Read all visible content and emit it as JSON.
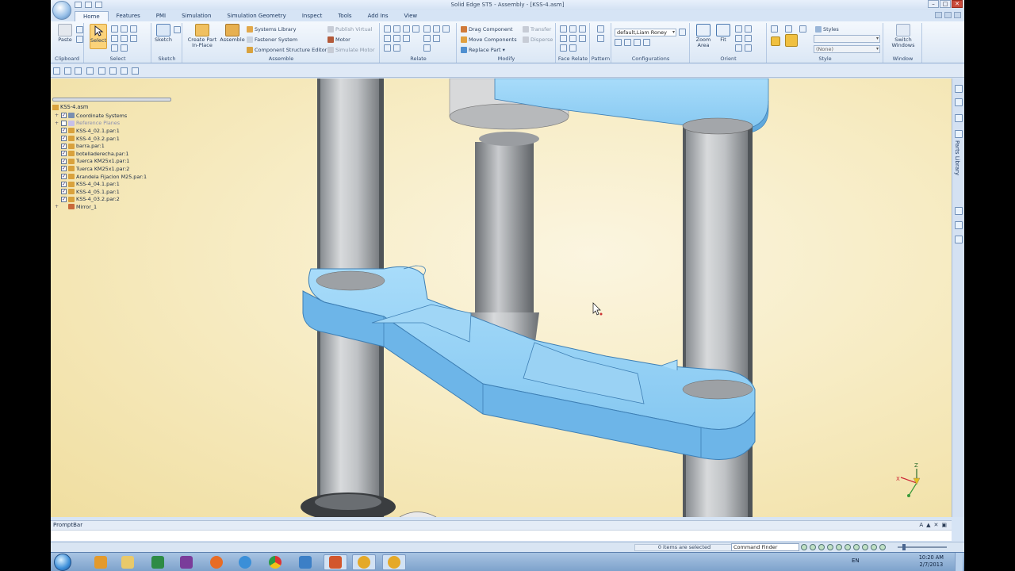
{
  "window": {
    "title": "Solid Edge ST5 - Assembly - [KSS-4.asm]"
  },
  "tabs": [
    "Home",
    "Features",
    "PMI",
    "Simulation",
    "Simulation Geometry",
    "Inspect",
    "Tools",
    "Add Ins",
    "View"
  ],
  "ribbon": {
    "clipboard": {
      "paste": "Paste",
      "label": "Clipboard"
    },
    "select": {
      "select": "Select",
      "label": "Select"
    },
    "sketch": {
      "sketch": "Sketch",
      "label": "Sketch"
    },
    "assemble": {
      "create_part": "Create Part",
      "in_place": "In-Place",
      "assemble": "Assemble",
      "systems_library": "Systems Library",
      "fastener_system": "Fastener System",
      "component_structure_editor": "Component Structure Editor",
      "publish_virtual": "Publish Virtual",
      "motor": "Motor",
      "simulate_motor": "Simulate Motor",
      "label": "Assemble"
    },
    "relate": {
      "label": "Relate"
    },
    "modify": {
      "drag_component": "Drag Component",
      "move_components": "Move Components",
      "replace_part": "Replace Part",
      "transfer": "Transfer",
      "disperse": "Disperse",
      "label": "Modify"
    },
    "face_relate": {
      "label": "Face Relate"
    },
    "pattern": {
      "label": "Pattern"
    },
    "configurations": {
      "combo_value": "default,Liam Roney",
      "label": "Configurations"
    },
    "orient": {
      "zoom_area_1": "Zoom",
      "zoom_area_2": "Area",
      "fit": "Fit",
      "label": "Orient"
    },
    "style": {
      "styles": "Styles",
      "none_value": "(None)",
      "label": "Style"
    },
    "window": {
      "switch_1": "Switch",
      "switch_2": "Windows",
      "label": "Window"
    }
  },
  "pathfinder": {
    "root": "KSS-4.asm",
    "items": [
      {
        "label": "Coordinate Systems",
        "expand": "+",
        "checked": true,
        "faded": false,
        "icon_color": "#7a8fb0"
      },
      {
        "label": "Reference Planes",
        "expand": "+",
        "checked": false,
        "faded": true,
        "icon_color": "#c7c0e8"
      },
      {
        "label": "KSS-4_02.1.par:1",
        "expand": "",
        "checked": true,
        "faded": false,
        "icon_color": "#d9a23d"
      },
      {
        "label": "KSS-4_03.2.par:1",
        "expand": "",
        "checked": true,
        "faded": false,
        "icon_color": "#d9a23d"
      },
      {
        "label": "barra.par:1",
        "expand": "",
        "checked": true,
        "faded": false,
        "icon_color": "#d9a23d"
      },
      {
        "label": "botelladerecha.par:1",
        "expand": "",
        "checked": true,
        "faded": false,
        "icon_color": "#d9a23d"
      },
      {
        "label": "Tuerca KM25x1.par:1",
        "expand": "",
        "checked": true,
        "faded": false,
        "icon_color": "#d9a23d"
      },
      {
        "label": "Tuerca KM25x1.par:2",
        "expand": "",
        "checked": true,
        "faded": false,
        "icon_color": "#d9a23d"
      },
      {
        "label": "Arandela Fijacion M25.par:1",
        "expand": "",
        "checked": true,
        "faded": false,
        "icon_color": "#d9a23d"
      },
      {
        "label": "KSS-4_04.1.par:1",
        "expand": "",
        "checked": true,
        "faded": false,
        "icon_color": "#d9a23d"
      },
      {
        "label": "KSS-4_05.1.par:1",
        "expand": "",
        "checked": true,
        "faded": false,
        "icon_color": "#d9a23d"
      },
      {
        "label": "KSS-4_03.2.par:2",
        "expand": "",
        "checked": true,
        "faded": false,
        "icon_color": "#d9a23d"
      },
      {
        "label": "Mirror_1",
        "expand": "+",
        "checked": null,
        "faded": false,
        "icon_color": "#c96a3a"
      }
    ]
  },
  "triad": {
    "x": "X",
    "z": "Z"
  },
  "dock": {
    "parts_library": "Parts Library"
  },
  "promptbar": {
    "label": "PromptBar",
    "controls": [
      "A",
      "▲",
      "✕",
      "▣"
    ]
  },
  "status": {
    "selection": "0 items are selected",
    "command_finder": "Command Finder"
  },
  "taskbar": {
    "lang": "EN",
    "time": "10:20 AM",
    "date": "2/7/2013"
  },
  "colors": {
    "part_blue": "#8fd0f5",
    "part_blue_dark": "#5fa8dc",
    "rod_light": "#d4d6d8",
    "rod_dark": "#6e7276",
    "viewport_bg": "#f7ecc4"
  }
}
